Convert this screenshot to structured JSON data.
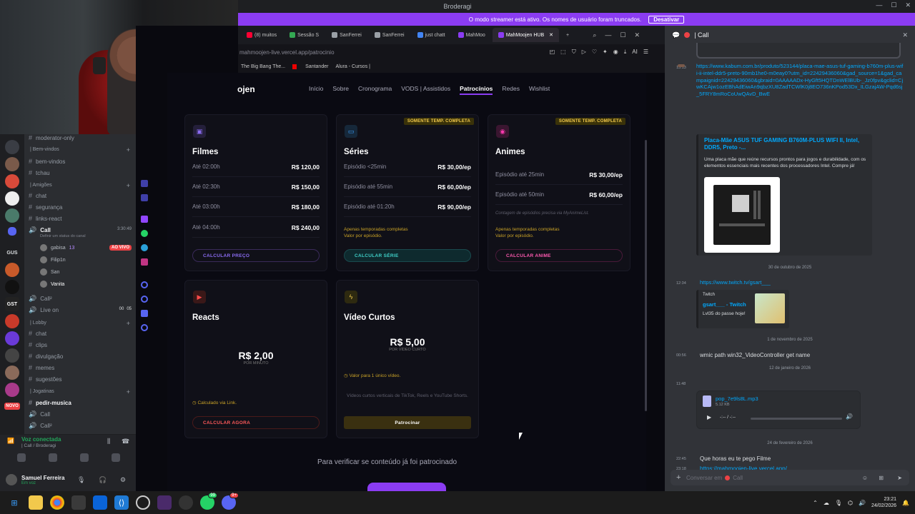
{
  "window": {
    "title": "Broderagi"
  },
  "streamer_banner": {
    "text": "O modo streamer está ativo. Os nomes de usuário foram truncados.",
    "button": "Desativar"
  },
  "discord": {
    "channels": [
      {
        "name": "moderator-only",
        "type": "text"
      },
      {
        "category": "| Bem-vindos"
      },
      {
        "name": "bem-vindos",
        "type": "text"
      },
      {
        "name": "tchau",
        "type": "text"
      },
      {
        "category": "| Amigões"
      },
      {
        "name": "chat",
        "type": "text"
      },
      {
        "name": "segurança",
        "type": "text"
      },
      {
        "name": "links-react",
        "type": "text"
      },
      {
        "name": "Call",
        "type": "voice",
        "status_hint": "Definir um status do canal",
        "timer": "3:30:49"
      },
      {
        "name": "Call²",
        "type": "voice"
      },
      {
        "name": "Live on",
        "type": "voice",
        "counts": [
          "00",
          "05"
        ]
      },
      {
        "category": "| Lobby"
      },
      {
        "name": "chat",
        "type": "text"
      },
      {
        "name": "clips",
        "type": "text"
      },
      {
        "name": "divulgação",
        "type": "text"
      },
      {
        "name": "memes",
        "type": "text"
      },
      {
        "name": "sugestões",
        "type": "text"
      },
      {
        "category": "| Jogatinas"
      },
      {
        "name": "pedir-musica",
        "type": "text"
      },
      {
        "name": "Call",
        "type": "voice"
      },
      {
        "name": "Call²",
        "type": "voice"
      }
    ],
    "voice_users": [
      {
        "name": "gabisa",
        "extra": "13",
        "badge": "AO VIVO"
      },
      {
        "name": "Filip1n"
      },
      {
        "name": "San"
      },
      {
        "name": "Vanita"
      }
    ],
    "guild_labels": [
      "GUS",
      "GST",
      "NOVO"
    ],
    "guild_badges": [
      "58",
      "118",
      "33"
    ],
    "voice_status": {
      "title": "Voz conectada",
      "channel": "| Call / Broderagi"
    },
    "user": {
      "name": "Samuel Ferreira",
      "status": "Em voz"
    }
  },
  "browser": {
    "tabs": [
      {
        "label": "(8) muitos",
        "color": "#ff0033"
      },
      {
        "label": "Sessão S",
        "color": "#34a853"
      },
      {
        "label": "SanFerrei",
        "color": "#9aa0a6"
      },
      {
        "label": "SanFerrei",
        "color": "#9aa0a6"
      },
      {
        "label": "just chatt",
        "color": "#4285f4"
      },
      {
        "label": "MahMoo",
        "color": "#8b3cf2"
      },
      {
        "label": "MahMoojen HUB",
        "color": "#8b3cf2",
        "active": true
      }
    ],
    "url": "mahmoojen-live.vercel.app/patrocinio",
    "bookmarks": [
      "The Big Bang The...",
      "Santander",
      "Alura - Cursos |"
    ]
  },
  "site": {
    "brand": "ojen",
    "nav": [
      "Início",
      "Sobre",
      "Cronograma",
      "VODS | Assistidos",
      "Patrocínios",
      "Redes",
      "Wishlist"
    ],
    "active_nav": "Patrocínios",
    "cards": {
      "filmes": {
        "title": "Filmes",
        "rows": [
          [
            "Até 02:00h",
            "R$ 120,00"
          ],
          [
            "Até 02:30h",
            "R$ 150,00"
          ],
          [
            "Até 03:00h",
            "R$ 180,00"
          ],
          [
            "Até 04:00h",
            "R$ 240,00"
          ]
        ],
        "button": "CALCULAR PREÇO"
      },
      "series": {
        "title": "Séries",
        "badge": "SOMENTE TEMP. COMPLETA",
        "rows": [
          [
            "Episódio <25min",
            "R$ 30,00/ep"
          ],
          [
            "Episódio até 55min",
            "R$ 60,00/ep"
          ],
          [
            "Episódio até 01:20h",
            "R$ 90,00/ep"
          ]
        ],
        "note": "Apenas temporadas completas\nValor por episódio.",
        "button": "CALCULAR SÉRIE"
      },
      "animes": {
        "title": "Animes",
        "badge": "SOMENTE TEMP. COMPLETA",
        "rows": [
          [
            "Episódio até 25min",
            "R$ 30,00/ep"
          ],
          [
            "Episódio até 50min",
            "R$ 60,00/ep"
          ]
        ],
        "hint": "Contagem de episódios precisa via MyAnimeList.",
        "note": "Apenas temporadas completas\nValor por episódio.",
        "button": "CALCULAR ANIME"
      },
      "reacts": {
        "title": "Reacts",
        "price": "R$ 2,00",
        "unit": "POR MINUTO",
        "note": "Calculado via Link.",
        "button": "CALCULAR AGORA"
      },
      "videos": {
        "title": "Vídeo Curtos",
        "price": "R$ 5,00",
        "unit": "POR VÍDEO CURTO",
        "note": "Valor para 1 único vídeo.",
        "desc": "Vídeos curtos verticais de TikTok, Reels e YouTube Shorts.",
        "button": "Patrocinar"
      }
    },
    "verify_text": "Para verificar se conteúdo já foi patrocinado"
  },
  "chat": {
    "channel": "| Call",
    "messages": [
      {
        "time": "15:13",
        "text": "https://www.kabum.com.br/produto/523144/placa-mae-asus-tuf-gaming-b760m-plus-wifi-ii-intel-ddr5-preto-90mb1he0-m0eay0?utm_id=22429436060&gad_source=1&gad_campaignid=22429436060&gbraid=0AAAAADx-HyGft5HQTDnWElBUb-_Jz0fpv&gclid=CjwKCAjw1ozEBhAdEiwAn9qbzXU8ZadTCWlK0j8EO736nKPod53Dx_ILGzajAW-Pqd6sj_5FRY8mRoCoUwQAvD_BwE"
      },
      {
        "embed_title": "Placa-Mãe ASUS TUF GAMING B760M-PLUS WIFI II, Intel, DDR5, Preto -...",
        "embed_desc": "Uma placa mãe que reúne recursos prontos para jogos e durabilidade, com os elementos essenciais mais recentes dos processadores Intel. Compre já!"
      },
      {
        "divider": "30 de outubro de 2025"
      },
      {
        "time": "12:34",
        "text": "https://www.twitch.tv/gsart___",
        "provider": "Twitch",
        "embed_title": "gsart___ - Twitch",
        "embed_desc": "Lvl35 do passe hoje!"
      },
      {
        "divider": "1 de novembro de 2025"
      },
      {
        "time": "00:56",
        "text": "wmic path win32_VideoController get name"
      },
      {
        "divider": "12 de janeiro de 2026"
      },
      {
        "time": "11:48",
        "file": "pop_7e9ls8L.mp3",
        "size": "5.12 KB",
        "player": "-:-- / -:--"
      },
      {
        "divider": "24 de fevereiro de 2026"
      },
      {
        "time": "22:45",
        "text": "Que horas eu te pego Filme"
      },
      {
        "time": "23:18",
        "text": "https://mahmoojen-live.vercel.app/"
      }
    ],
    "input_placeholder": "Conversar em",
    "input_channel": "Call"
  },
  "taskbar": {
    "time": "23:21",
    "date": "24/02/2026",
    "badges": [
      "99",
      "9+"
    ]
  }
}
